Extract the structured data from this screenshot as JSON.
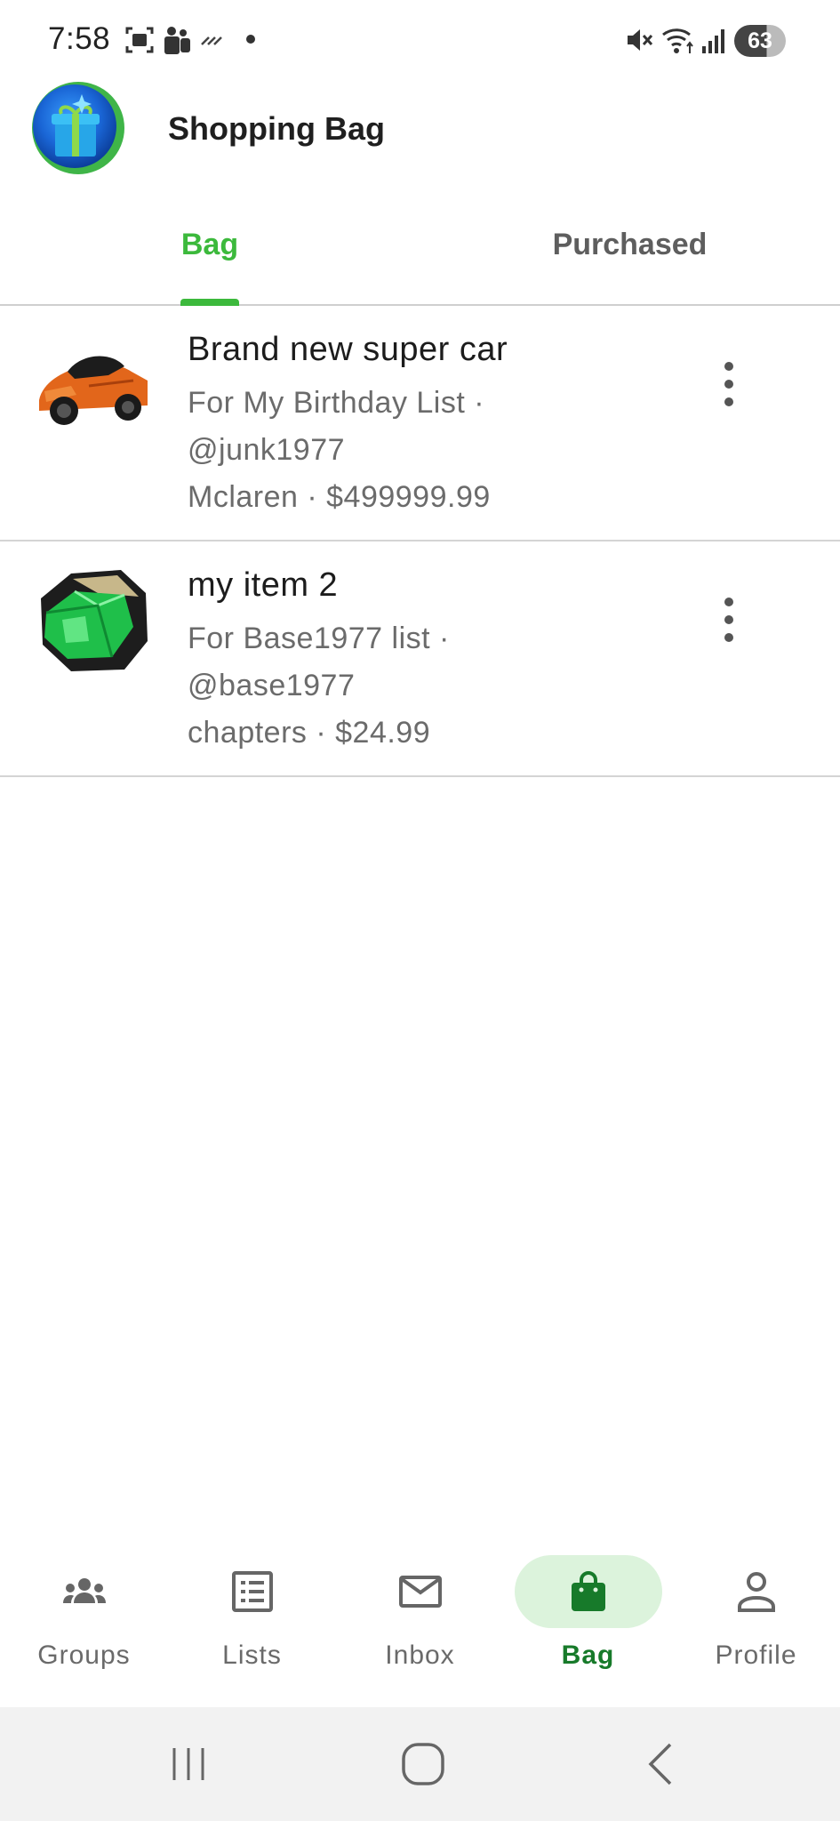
{
  "status_bar": {
    "time": "7:58",
    "battery": "63",
    "icons": [
      "screenshot-icon",
      "teams-icon",
      "signal-strip-icon",
      "dot-icon",
      "mute-icon",
      "wifi-icon",
      "cell-signal-icon",
      "battery-icon"
    ]
  },
  "header": {
    "title": "Shopping Bag",
    "logo": "gift-logo"
  },
  "tabs": [
    {
      "label": "Bag",
      "active": true
    },
    {
      "label": "Purchased",
      "active": false
    }
  ],
  "items": [
    {
      "title": "Brand new super car",
      "line1": "For My Birthday List ·",
      "line2": "@junk1977",
      "line3": "Mclaren · $499999.99",
      "thumbnail": "orange-sports-car",
      "menu_icon": "more-vert-icon"
    },
    {
      "title": "my item 2",
      "line1": "For Base1977  list ·",
      "line2": "@base1977",
      "line3": "chapters · $24.99",
      "thumbnail": "green-gem",
      "menu_icon": "more-vert-icon"
    }
  ],
  "bottom_nav": [
    {
      "label": "Groups",
      "icon": "groups-icon",
      "active": false
    },
    {
      "label": "Lists",
      "icon": "list-icon",
      "active": false
    },
    {
      "label": "Inbox",
      "icon": "mail-icon",
      "active": false
    },
    {
      "label": "Bag",
      "icon": "shopping-bag-icon",
      "active": true
    },
    {
      "label": "Profile",
      "icon": "person-icon",
      "active": false
    }
  ],
  "colors": {
    "accent": "#3cb93c",
    "nav_active_text": "#177a2a",
    "nav_active_pill": "#dcf3dc",
    "secondary_text": "#6b6b6b"
  }
}
